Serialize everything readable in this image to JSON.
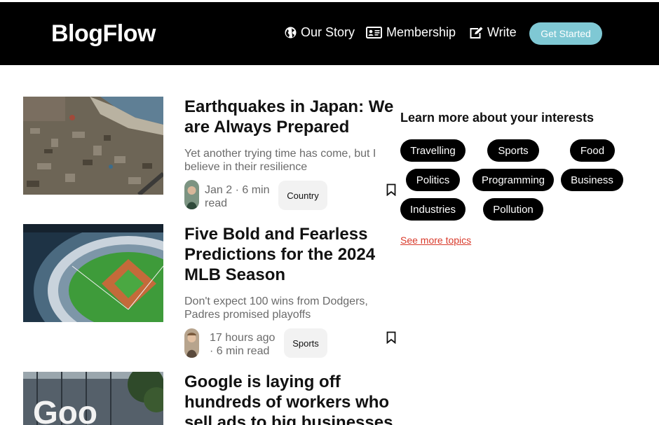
{
  "header": {
    "logo": "BlogFlow",
    "nav": [
      {
        "label": "Our Story",
        "icon": "globe-icon"
      },
      {
        "label": "Membership",
        "icon": "id-card-icon"
      },
      {
        "label": "Write",
        "icon": "edit-icon"
      }
    ],
    "cta_label": "Get Started",
    "colors": {
      "background": "#000000",
      "cta": "#7fc8d4"
    }
  },
  "articles": [
    {
      "title": "Earthquakes in Japan: We are Always Prepared",
      "subtitle": "Yet another trying time has come, but I believe in their resilience",
      "meta_line1": "Jan 2 · 6 min",
      "meta_line2": "read",
      "tag": "Country",
      "image": "earthquake-aerial-photo"
    },
    {
      "title": "Five Bold and Fearless Predictions for the 2024 MLB Season",
      "subtitle": "Don't expect 100 wins from Dodgers, Padres promised playoffs",
      "meta_line1": "17 hours ago",
      "meta_line2": "· 6 min read",
      "tag": "Sports",
      "image": "baseball-stadium-photo"
    },
    {
      "title": "Google is laying off hundreds of workers who sell ads to big businesses",
      "image": "google-sign-photo"
    }
  ],
  "sidebar": {
    "heading": "Learn more about your interests",
    "topics": [
      "Travelling",
      "Sports",
      "Food",
      "Politics",
      "Programming",
      "Business",
      "Industries",
      "Pollution"
    ],
    "see_more": "See more topics",
    "colors": {
      "pill": "#000000",
      "link": "#d93a2b"
    }
  }
}
